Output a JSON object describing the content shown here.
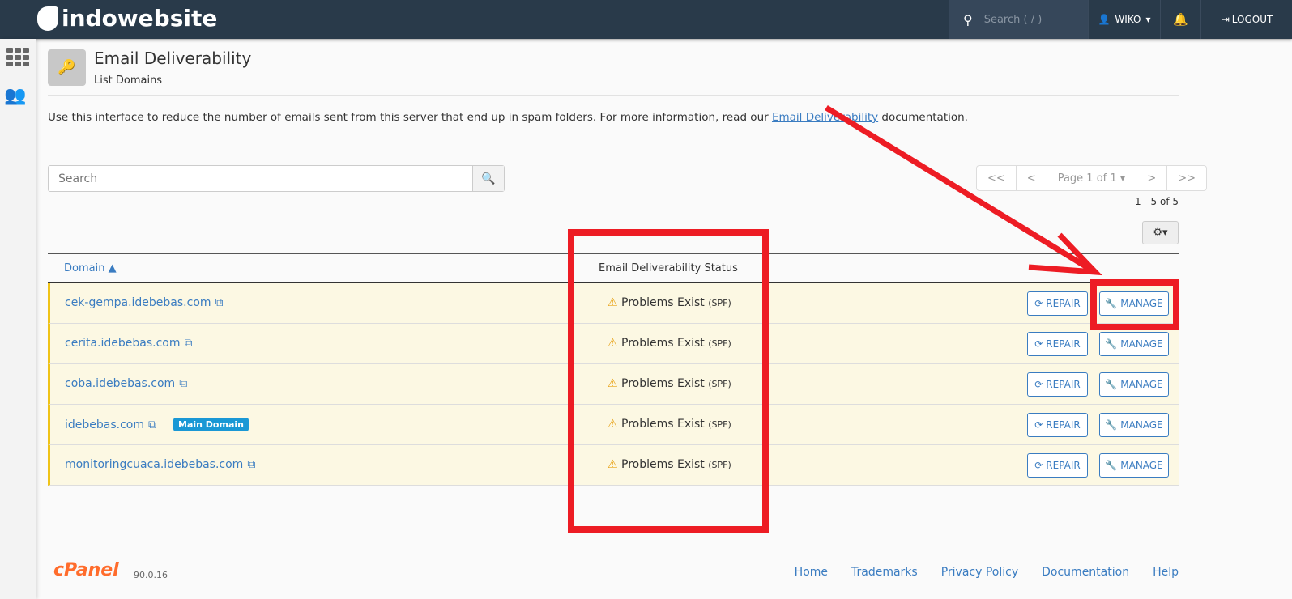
{
  "header": {
    "brand": "indowebsite",
    "search_placeholder": "Search ( / )",
    "user": "WIKO",
    "logout": "LOGOUT"
  },
  "page": {
    "title": "Email Deliverability",
    "subtitle": "List Domains",
    "desc_before": "Use this interface to reduce the number of emails sent from this server that end up in spam folders. For more information, read our ",
    "desc_link": "Email Deliverability",
    "desc_after": " documentation."
  },
  "search": {
    "placeholder": "Search"
  },
  "pager": {
    "first": "<<",
    "prev": "<",
    "page": "Page 1 of 1 ▾",
    "next": ">",
    "last": ">>",
    "count": "1 - 5 of 5"
  },
  "table": {
    "col_domain": "Domain ▲",
    "col_status": "Email Deliverability Status",
    "rows": [
      {
        "domain": "cek-gempa.idebebas.com",
        "badge": "",
        "status": "Problems Exist",
        "detail": "(SPF)"
      },
      {
        "domain": "cerita.idebebas.com",
        "badge": "",
        "status": "Problems Exist",
        "detail": "(SPF)"
      },
      {
        "domain": "coba.idebebas.com",
        "badge": "",
        "status": "Problems Exist",
        "detail": "(SPF)"
      },
      {
        "domain": "idebebas.com",
        "badge": "Main Domain",
        "status": "Problems Exist",
        "detail": "(SPF)"
      },
      {
        "domain": "monitoringcuaca.idebebas.com",
        "badge": "",
        "status": "Problems Exist",
        "detail": "(SPF)"
      }
    ],
    "repair": "REPAIR",
    "manage": "MANAGE"
  },
  "footer": {
    "logo": "cPanel",
    "version": "90.0.16",
    "links": [
      "Home",
      "Trademarks",
      "Privacy Policy",
      "Documentation",
      "Help"
    ]
  },
  "annotation_color": "#ed1c24"
}
